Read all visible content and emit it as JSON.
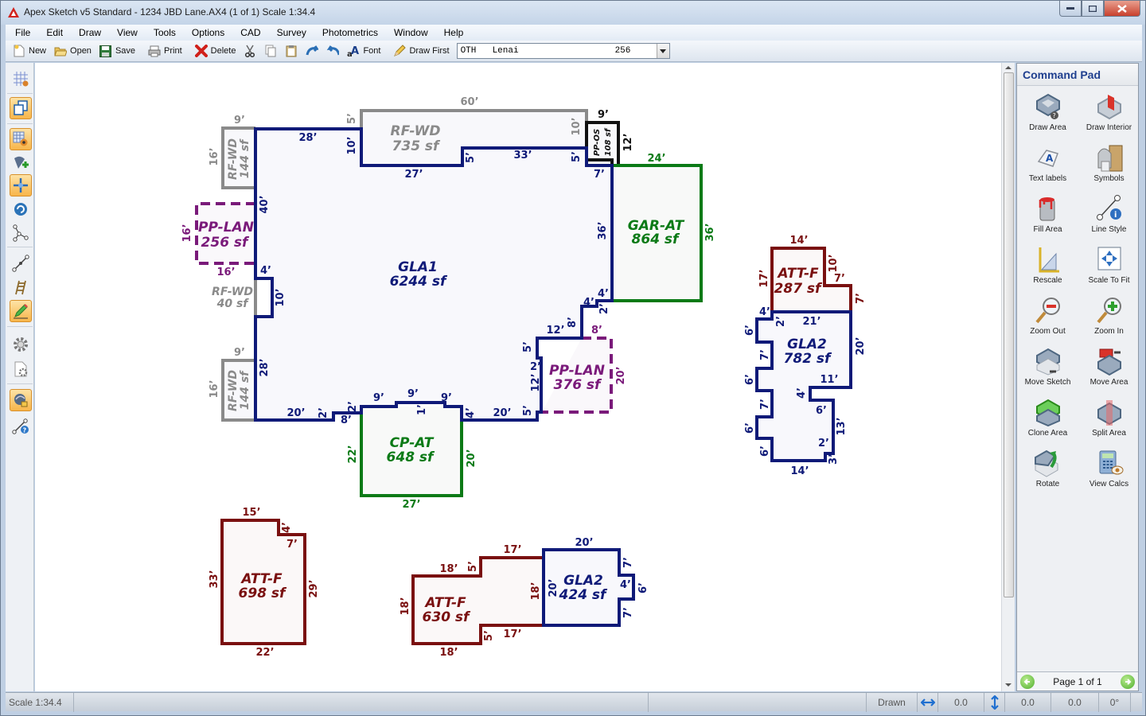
{
  "window": {
    "title": "Apex Sketch v5 Standard - 1234 JBD Lane.AX4 (1 of 1)  Scale 1:34.4",
    "controls": [
      "minimize",
      "maximize",
      "close"
    ]
  },
  "menu": [
    "File",
    "Edit",
    "Draw",
    "View",
    "Tools",
    "Options",
    "CAD",
    "Survey",
    "Photometrics",
    "Window",
    "Help"
  ],
  "toolbar": {
    "new": "New",
    "open": "Open",
    "save": "Save",
    "print": "Print",
    "delete": "Delete",
    "font": "Font",
    "draw_first": "Draw First",
    "combo": {
      "code": "OTH",
      "name": "Lenai",
      "value": "256"
    }
  },
  "left_tools": [
    "grid-view",
    "overlay-toggle",
    "grid-preview",
    "add-node",
    "crosshair-move",
    "rotate-refresh",
    "node-tree",
    "line-tool",
    "stair-tool",
    "pencil-draw",
    "settings",
    "document-settings",
    "mouse-lock",
    "line-help"
  ],
  "command_pad": {
    "title": "Command Pad",
    "items": [
      {
        "label": "Draw Area",
        "icon": "draw-area"
      },
      {
        "label": "Draw Interior",
        "icon": "draw-interior"
      },
      {
        "label": "Text labels",
        "icon": "text-labels"
      },
      {
        "label": "Symbols",
        "icon": "symbols"
      },
      {
        "label": "Fill Area",
        "icon": "paint-bucket"
      },
      {
        "label": "Line Style",
        "icon": "line-style"
      },
      {
        "label": "Rescale",
        "icon": "ruler-triangle"
      },
      {
        "label": "Scale To Fit",
        "icon": "scale-to-fit"
      },
      {
        "label": "Zoom Out",
        "icon": "zoom-out"
      },
      {
        "label": "Zoom In",
        "icon": "zoom-in"
      },
      {
        "label": "Move Sketch",
        "icon": "move-sketch"
      },
      {
        "label": "Move Area",
        "icon": "move-area"
      },
      {
        "label": "Clone Area",
        "icon": "clone-area"
      },
      {
        "label": "Split Area",
        "icon": "split-area"
      },
      {
        "label": "Rotate",
        "icon": "rotate"
      },
      {
        "label": "View Calcs",
        "icon": "calculator"
      }
    ],
    "pager": "Page 1 of 1"
  },
  "status": {
    "scale": "Scale 1:34.4",
    "state": "Drawn",
    "x": "0.0",
    "y": "0.0",
    "len": "0.0",
    "angle": "0°"
  },
  "colors": {
    "gla": "#0f1a78",
    "garage": "#0b7a16",
    "roof": "#8a8a8a",
    "porch": "#7a1a7a",
    "attic": "#7a1010",
    "pp_os": "#111111"
  },
  "sketch": {
    "areas": [
      {
        "code": "GLA1",
        "area": "6244 sf"
      },
      {
        "code": "RF-WD",
        "area": "735 sf"
      },
      {
        "code": "RF-WD",
        "area": "144 sf"
      },
      {
        "code": "RF-WD",
        "area": "144 sf"
      },
      {
        "code": "RF-WD",
        "area": "40 sf"
      },
      {
        "code": "PP-LAN",
        "area": "256 sf"
      },
      {
        "code": "PP-LAN",
        "area": "376 sf"
      },
      {
        "code": "PP-OS",
        "area": "108 sf"
      },
      {
        "code": "GAR-AT",
        "area": "864 sf"
      },
      {
        "code": "CP-AT",
        "area": "648 sf"
      },
      {
        "code": "ATT-F",
        "area": "287 sf"
      },
      {
        "code": "GLA2",
        "area": "782 sf"
      },
      {
        "code": "ATT-F",
        "area": "698 sf"
      },
      {
        "code": "ATT-F",
        "area": "630 sf"
      },
      {
        "code": "GLA2",
        "area": "424 sf"
      }
    ],
    "dims": {
      "rfwd735": [
        "60’",
        "5’",
        "10’"
      ],
      "ppos": [
        "9’",
        "12’"
      ],
      "rfwd144a": [
        "9’",
        "16’"
      ],
      "pplan256": [
        "16’",
        "16’"
      ],
      "rfwd144b": [
        "9’",
        "16’"
      ],
      "gla1": [
        "28’",
        "10’",
        "27’",
        "5’",
        "33’",
        "5’",
        "7’",
        "36’",
        "4’",
        "2’",
        "4’",
        "8’",
        "12’",
        "5’",
        "2’",
        "12’",
        "5’",
        "20’",
        "4’",
        "9’",
        "1’",
        "9’",
        "9’",
        "2’",
        "8’",
        "2’",
        "20’",
        "28’",
        "10’",
        "4’",
        "40’"
      ],
      "gar": [
        "24’",
        "36’"
      ],
      "pplan376": [
        "8’",
        "20’"
      ],
      "cpat": [
        "22’",
        "20’",
        "27’"
      ],
      "attf287": [
        "14’",
        "10’",
        "7’",
        "7’",
        "17’"
      ],
      "gla2a": [
        "4’",
        "2’",
        "21’",
        "20’",
        "11’",
        "4’",
        "6’",
        "13’",
        "2’",
        "3’",
        "14’",
        "6’",
        "6’",
        "7’",
        "6’",
        "7’",
        "6’"
      ],
      "attf698": [
        "15’",
        "4’",
        "7’",
        "29’",
        "22’",
        "33’"
      ],
      "attf630": [
        "18’",
        "5’",
        "17’",
        "18’",
        "17’",
        "5’",
        "18’",
        "18’"
      ],
      "gla2b": [
        "20’",
        "7’",
        "4’",
        "6’",
        "7’",
        "20’"
      ]
    }
  }
}
